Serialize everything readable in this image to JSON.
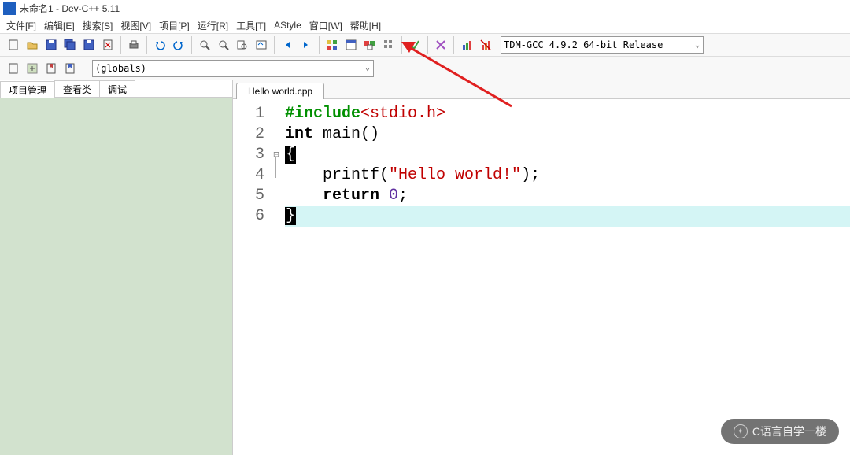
{
  "window": {
    "title": "未命名1 - Dev-C++ 5.11"
  },
  "menubar": [
    "文件[F]",
    "编辑[E]",
    "搜索[S]",
    "视图[V]",
    "项目[P]",
    "运行[R]",
    "工具[T]",
    "AStyle",
    "窗口[W]",
    "帮助[H]"
  ],
  "compiler_selector": "TDM-GCC 4.9.2 64-bit Release",
  "globals_selector": "(globals)",
  "left_tabs": [
    "项目管理",
    "查看类",
    "调试"
  ],
  "file_tab": "Hello world.cpp",
  "code": {
    "lines": [
      "1",
      "2",
      "3",
      "4",
      "5",
      "6"
    ],
    "l1_inc": "#include",
    "l1_hdr": "<stdio.h>",
    "l2_int": "int",
    "l2_main": " main()",
    "l3": "{",
    "l4_pre": "    printf(",
    "l4_str": "\"Hello world!\"",
    "l4_post": ");",
    "l5_pre": "    ",
    "l5_ret": "return",
    "l5_sp": " ",
    "l5_zero": "0",
    "l5_semi": ";",
    "l6": "}"
  },
  "watermark": "C语言自学一楼"
}
